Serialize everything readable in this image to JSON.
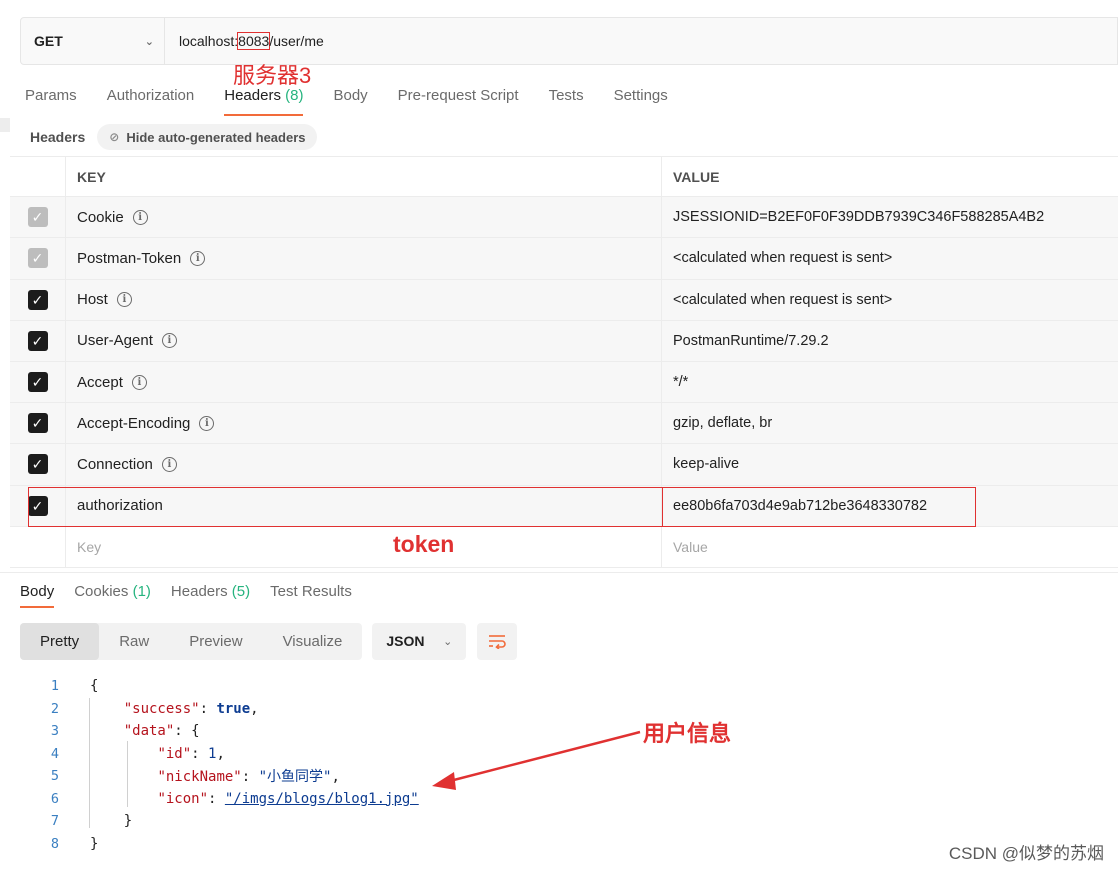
{
  "request": {
    "method": "GET",
    "url_prefix": "localhost:",
    "url_port": "8083",
    "url_path": "/user/me"
  },
  "annotations": {
    "server": "服务器3",
    "token": "token",
    "user_info": "用户信息",
    "color": "#e03131"
  },
  "request_tabs": [
    {
      "label": "Params"
    },
    {
      "label": "Authorization"
    },
    {
      "label": "Headers",
      "count": "(8)",
      "active": true
    },
    {
      "label": "Body"
    },
    {
      "label": "Pre-request Script"
    },
    {
      "label": "Tests"
    },
    {
      "label": "Settings"
    }
  ],
  "headers_section": {
    "label": "Headers",
    "hide_button": "Hide auto-generated headers"
  },
  "table": {
    "key_header": "KEY",
    "value_header": "VALUE",
    "rows": [
      {
        "key": "Cookie",
        "value": "JSESSIONID=B2EF0F0F39DDB7939C346F588285A4B2",
        "checked": "dim",
        "info": true
      },
      {
        "key": "Postman-Token",
        "value": "<calculated when request is sent>",
        "checked": "dim",
        "info": true
      },
      {
        "key": "Host",
        "value": "<calculated when request is sent>",
        "checked": "on",
        "info": true
      },
      {
        "key": "User-Agent",
        "value": "PostmanRuntime/7.29.2",
        "checked": "on",
        "info": true
      },
      {
        "key": "Accept",
        "value": "*/*",
        "checked": "on",
        "info": true
      },
      {
        "key": "Accept-Encoding",
        "value": "gzip, deflate, br",
        "checked": "on",
        "info": true
      },
      {
        "key": "Connection",
        "value": "keep-alive",
        "checked": "on",
        "info": true
      },
      {
        "key": "authorization",
        "value": "ee80b6fa703d4e9ab712be3648330782",
        "checked": "on",
        "info": false
      }
    ],
    "placeholder_key": "Key",
    "placeholder_value": "Value"
  },
  "response_tabs": [
    {
      "label": "Body",
      "active": true
    },
    {
      "label": "Cookies",
      "count": "(1)"
    },
    {
      "label": "Headers",
      "count": "(5)"
    },
    {
      "label": "Test Results"
    }
  ],
  "view_modes": [
    "Pretty",
    "Raw",
    "Preview",
    "Visualize"
  ],
  "format": "JSON",
  "code_lines": [
    "1",
    "2",
    "3",
    "4",
    "5",
    "6",
    "7",
    "8"
  ],
  "code": {
    "success_key": "\"success\"",
    "success_val": "true",
    "data_key": "\"data\"",
    "id_key": "\"id\"",
    "id_val": "1",
    "nick_key": "\"nickName\"",
    "nick_val": "\"小鱼同学\"",
    "icon_key": "\"icon\"",
    "icon_val": "\"/imgs/blogs/blog1.jpg\""
  },
  "watermark": "CSDN @似梦的苏烟"
}
